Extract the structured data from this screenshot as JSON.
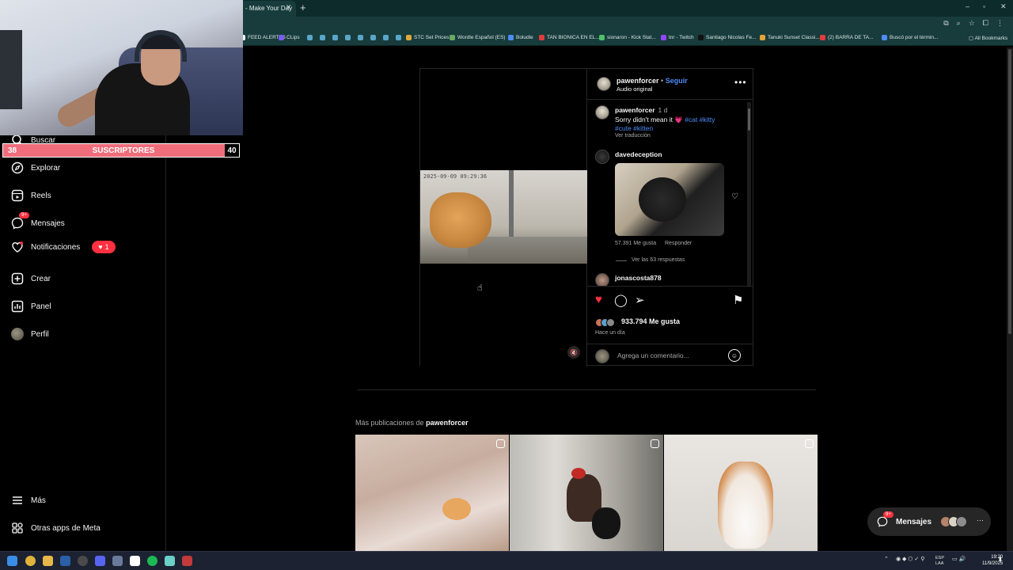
{
  "browser": {
    "tab_title": "- Make Your Day",
    "bookmarks": [
      {
        "label": "FEED ALERTAS",
        "color": "#f5f5f5"
      },
      {
        "label": "CLips",
        "color": "#7a5cf0"
      },
      {
        "label": "STC Set Prices",
        "color": "#e0a83a"
      },
      {
        "label": "Wordle Español (ES)",
        "color": "#6aaa64"
      },
      {
        "label": "Boludle",
        "color": "#4f8cf7"
      },
      {
        "label": "TAN BIONICA EN EL...",
        "color": "#e23b3b"
      },
      {
        "label": "sionaron - Kick Stat...",
        "color": "#4fbf6b"
      },
      {
        "label": "tnr - Twitch",
        "color": "#9146ff"
      },
      {
        "label": "Santiago Nicolas Fe...",
        "color": "#111111"
      },
      {
        "label": "Tanuki Sunset Classi...",
        "color": "#e3a23a"
      },
      {
        "label": "(2) BARRA DE TA...",
        "color": "#e23b3b"
      },
      {
        "label": "Buscó por el términ...",
        "color": "#4f8cf7"
      }
    ],
    "all_bookmarks": "All Bookmarks"
  },
  "overlay": {
    "subs_current": "38",
    "subs_label": "SUSCRIPTORES",
    "subs_goal": "40"
  },
  "sidebar": {
    "items": [
      {
        "label": "Buscar",
        "icon": "search-icon"
      },
      {
        "label": "Explorar",
        "icon": "compass-icon"
      },
      {
        "label": "Reels",
        "icon": "reels-icon"
      },
      {
        "label": "Mensajes",
        "icon": "messenger-icon",
        "badge": "9+"
      },
      {
        "label": "Notificaciones",
        "icon": "heart-icon",
        "pill": "1"
      },
      {
        "label": "Crear",
        "icon": "plus-square-icon"
      },
      {
        "label": "Panel",
        "icon": "chart-icon"
      },
      {
        "label": "Perfil",
        "icon": "avatar-icon"
      }
    ],
    "more": "Más",
    "meta": "Otras apps de Meta"
  },
  "post": {
    "video_timestamp": "2025-09-09 09:29:36",
    "author": "pawenforcer",
    "dot": "•",
    "follow": "Seguir",
    "audio": "Audio original",
    "caption_user": "pawenforcer",
    "caption_time": "1 d",
    "caption_text": "Sorry didn't mean it 💗",
    "hashtags_1": "#cat #kitty",
    "hashtags_2": "#cute #kitten",
    "translate": "Ver traducción",
    "comment1_user": "davedeception",
    "comment1_likes": "57.391 Me gusta",
    "comment1_reply": "Responder",
    "comment1_replies": "Ver las 63 respuestas",
    "comment2_user": "jonascosta878",
    "likes": "933.794 Me gusta",
    "ago": "Hace un día",
    "add_comment": "Agrega un comentario..."
  },
  "more_posts": {
    "prefix": "Más publicaciones de",
    "user": "pawenforcer"
  },
  "messages_pill": {
    "label": "Mensajes",
    "badge": "9+"
  },
  "taskbar": {
    "lang": "ESP",
    "lang2": "LAA",
    "time": "19:20",
    "date": "11/9/2025"
  }
}
